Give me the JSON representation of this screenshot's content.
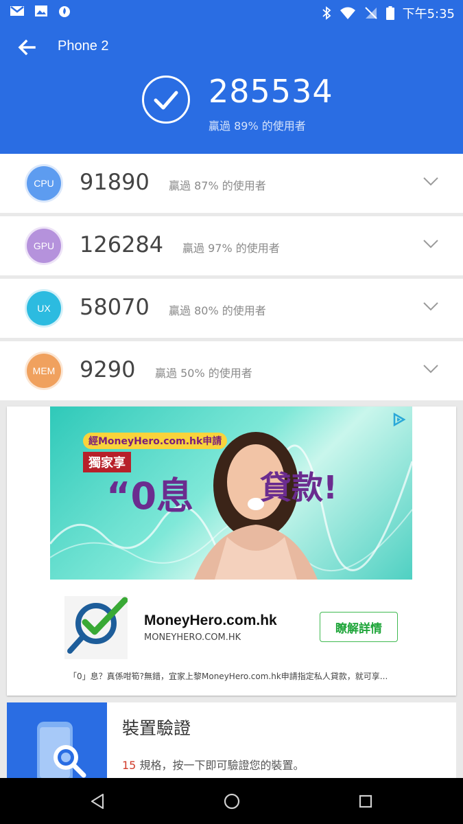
{
  "status_bar": {
    "time": "下午5:35",
    "left_icons": [
      "gmail-icon",
      "gallery-icon",
      "app-flame-icon"
    ],
    "right_icons": [
      "bluetooth-icon",
      "wifi-icon",
      "no-signal-icon",
      "battery-icon"
    ]
  },
  "header": {
    "title": "Phone 2",
    "total_score": "285534",
    "total_pct": "贏過 89% 的使用者",
    "bg_color": "#2a6de3"
  },
  "scores": [
    {
      "label": "CPU",
      "score": "91890",
      "pct": "贏過 87% 的使用者",
      "color": "#5d9cf0"
    },
    {
      "label": "GPU",
      "score": "126284",
      "pct": "贏過 97% 的使用者",
      "color": "#b592dc"
    },
    {
      "label": "UX",
      "score": "58070",
      "pct": "贏過 80% 的使用者",
      "color": "#2cbbe0"
    },
    {
      "label": "MEM",
      "score": "9290",
      "pct": "贏過 50% 的使用者",
      "color": "#f0a15e"
    }
  ],
  "ad": {
    "banner_text": {
      "brand_tag": "經MoneyHero.com.hk申請",
      "exclusive": "獨家享",
      "headline": "“0息",
      "headline_end": "貸款!"
    },
    "brand": "MoneyHero.com.hk",
    "url": "MONEYHERO.COM.HK",
    "cta": "瞭解詳情",
    "description": "「0」息？真係咁筍?無錯，宜家上黎MoneyHero.com.hk申請指定私人貸款，就可享..."
  },
  "verify": {
    "title": "裝置驗證",
    "count": "15",
    "subtitle_rest": " 規格，按一下即可驗證您的裝置。"
  },
  "nav": {
    "icons": [
      "back-triangle-icon",
      "home-circle-icon",
      "recents-square-icon"
    ]
  }
}
